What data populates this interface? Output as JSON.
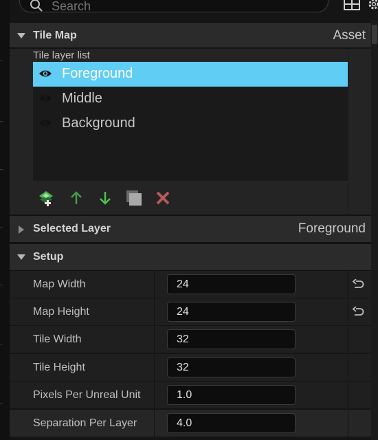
{
  "search": {
    "placeholder": "Search"
  },
  "tile_map_section": {
    "title": "Tile Map",
    "value": "Asset"
  },
  "tile_layer_list": {
    "label": "Tile layer list",
    "layers": [
      {
        "name": "Foreground",
        "selected": true
      },
      {
        "name": "Middle",
        "selected": false
      },
      {
        "name": "Background",
        "selected": false
      }
    ]
  },
  "layer_tools": [
    "add-layer-icon",
    "move-up-icon",
    "move-down-icon",
    "duplicate-icon",
    "delete-icon"
  ],
  "selected_layer_section": {
    "title": "Selected Layer",
    "value": "Foreground"
  },
  "setup_section": {
    "title": "Setup"
  },
  "setup_properties": [
    {
      "label": "Map Width",
      "value": "24",
      "resettable": true
    },
    {
      "label": "Map Height",
      "value": "24",
      "resettable": true
    },
    {
      "label": "Tile Width",
      "value": "32",
      "resettable": false
    },
    {
      "label": "Tile Height",
      "value": "32",
      "resettable": false
    },
    {
      "label": "Pixels Per Unreal Unit",
      "value": "1.0",
      "resettable": false
    },
    {
      "label": "Separation Per Layer",
      "value": "4.0",
      "resettable": false
    }
  ],
  "colors": {
    "selection": "#5fcdf4",
    "header": "#2b2b2b",
    "panel": "#242424"
  }
}
